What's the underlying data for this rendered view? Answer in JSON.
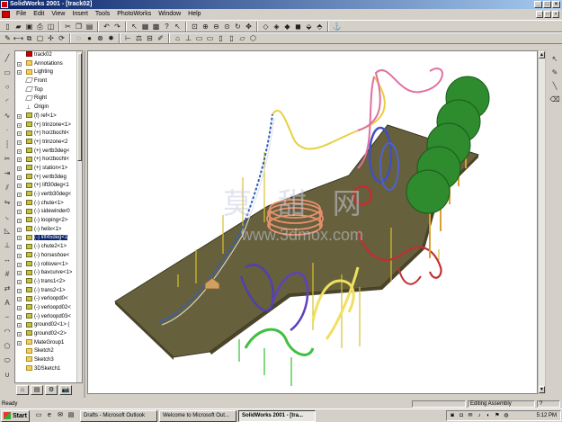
{
  "window": {
    "title": "SolidWorks 2001 - [track02]",
    "controls": [
      "_",
      "□",
      "×"
    ]
  },
  "menu": [
    "File",
    "Edit",
    "View",
    "Insert",
    "Tools",
    "PhotoWorks",
    "Window",
    "Help"
  ],
  "toolbar1_icons": [
    "new-icon",
    "open-icon",
    "save-icon",
    "print-icon",
    "print-preview-icon",
    "cut-icon",
    "copy-icon",
    "paste-icon",
    "undo-icon",
    "redo-icon",
    "select-icon",
    "rebuild-icon",
    "options-icon",
    "help-icon",
    "whats-this-icon",
    "zoom-fit-icon",
    "zoom-window-icon",
    "zoom-in-out-icon",
    "zoom-selection-icon",
    "rotate-icon",
    "pan-icon",
    "wireframe-icon",
    "hidden-lines-icon",
    "hidden-removed-icon",
    "shaded-icon",
    "perspective-icon",
    "section-icon"
  ],
  "toolbar2_icons": [
    "sketch-icon",
    "smart-dimension-icon",
    "mate-icon",
    "insert-component-icon",
    "move-icon",
    "rotate-component-icon",
    "hide-icon",
    "show-icon",
    "interference-icon",
    "explode-icon",
    "measure-icon",
    "mass-properties-icon",
    "section-view-icon",
    "edit-part-icon",
    "view-orientation-icon",
    "normal-to-icon",
    "front-icon",
    "back-icon",
    "left-icon",
    "right-icon",
    "top-icon",
    "iso-icon"
  ],
  "tree": {
    "items": [
      {
        "label": "track02",
        "icon": "root",
        "expander": ""
      },
      {
        "label": "Annotations",
        "icon": "folder",
        "expander": "+"
      },
      {
        "label": "Lighting",
        "icon": "folder",
        "expander": "+"
      },
      {
        "label": "Front",
        "icon": "plane",
        "expander": ""
      },
      {
        "label": "Top",
        "icon": "plane",
        "expander": ""
      },
      {
        "label": "Right",
        "icon": "plane",
        "expander": ""
      },
      {
        "label": "Origin",
        "icon": "origin",
        "expander": ""
      },
      {
        "label": "(f) ref<1>",
        "icon": "part",
        "expander": "+"
      },
      {
        "label": "(+) trinzone<1>",
        "icon": "part",
        "expander": "+"
      },
      {
        "label": "(+) horzbocht<",
        "icon": "part",
        "expander": "+"
      },
      {
        "label": "(+) trinzone<2",
        "icon": "part",
        "expander": "+"
      },
      {
        "label": "(+) vertb3deg<",
        "icon": "part",
        "expander": "+"
      },
      {
        "label": "(+) horzbocht<",
        "icon": "part",
        "expander": "+"
      },
      {
        "label": "(+) station<1>",
        "icon": "part",
        "expander": "+"
      },
      {
        "label": "(+) vertb3deg",
        "icon": "part",
        "expander": "+"
      },
      {
        "label": "(+) lift30deg<1",
        "icon": "part",
        "expander": "+"
      },
      {
        "label": "(-) vertb30deg<",
        "icon": "part",
        "expander": "+"
      },
      {
        "label": "(-) chute<1>",
        "icon": "part",
        "expander": "+"
      },
      {
        "label": "(-) sidewinder0",
        "icon": "part",
        "expander": "+"
      },
      {
        "label": "(-) looping<2>",
        "icon": "part",
        "expander": "+"
      },
      {
        "label": "(-) helix<1>",
        "icon": "part",
        "expander": "+"
      },
      {
        "label": "(-) lift45deg<1",
        "icon": "part",
        "expander": "+",
        "selected": true
      },
      {
        "label": "(-) chute2<1>",
        "icon": "part",
        "expander": "+"
      },
      {
        "label": "(-) horseshoe<",
        "icon": "part",
        "expander": "+"
      },
      {
        "label": "(-) rollover<1>",
        "icon": "part",
        "expander": "+"
      },
      {
        "label": "(-) bavcurve<1>",
        "icon": "part",
        "expander": "+"
      },
      {
        "label": "(-) trans1<2>",
        "icon": "part",
        "expander": "+"
      },
      {
        "label": "(-) trans2<1>",
        "icon": "part",
        "expander": "+"
      },
      {
        "label": "(-) verloopd0<",
        "icon": "part",
        "expander": "+"
      },
      {
        "label": "(-) verloopd02<",
        "icon": "part",
        "expander": "+"
      },
      {
        "label": "(-) verloopd03<",
        "icon": "part",
        "expander": "+"
      },
      {
        "label": "ground02<1> (",
        "icon": "part",
        "expander": "+"
      },
      {
        "label": "ground02<2>",
        "icon": "part",
        "expander": "+"
      },
      {
        "label": "MateGroup1",
        "icon": "folder",
        "expander": "+"
      },
      {
        "label": "Sketch2",
        "icon": "folder",
        "expander": ""
      },
      {
        "label": "Sketch3",
        "icon": "folder",
        "expander": ""
      },
      {
        "label": "3DSketch1",
        "icon": "folder",
        "expander": ""
      }
    ]
  },
  "tree_tabs": [
    "feature-manager-tab",
    "property-manager-tab",
    "configuration-manager-tab",
    "photoworks-tab"
  ],
  "viewport": {
    "watermark_cn": "莫 甜 网",
    "watermark_url": "www.3dmox.com",
    "ground_color": "#66603c",
    "tree_color": "#2e8b2e"
  },
  "status": {
    "left": "Ready",
    "right": "Editing Assembly"
  },
  "taskbar": {
    "start": "Start",
    "tasks": [
      {
        "label": "Drafts - Microsoft Outlook",
        "active": false
      },
      {
        "label": "Welcome to Microsoft Out...",
        "active": false
      },
      {
        "label": "SolidWorks 2001 - [tra...",
        "active": true
      }
    ],
    "clock": "5:12 PM"
  }
}
